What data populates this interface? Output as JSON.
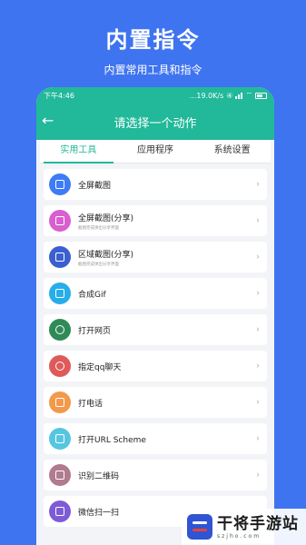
{
  "hero": {
    "title": "内置指令",
    "subtitle": "内置常用工具和指令"
  },
  "statusbar": {
    "time": "下午4:46",
    "net_speed": "...19.0K/s",
    "sim_badge": "④",
    "wifi": "⌔",
    "battery_label": ""
  },
  "navbar": {
    "back_icon": "←",
    "title": "请选择一个动作"
  },
  "tabs": [
    {
      "label": "实用工具",
      "active": true
    },
    {
      "label": "应用程序",
      "active": false
    },
    {
      "label": "系统设置",
      "active": false
    }
  ],
  "items": [
    {
      "label": "全屏截图",
      "sublabel": "",
      "icon": "fullscreen-capture-icon",
      "color": "#3d7cf5"
    },
    {
      "label": "全屏截图(分享)",
      "sublabel": "截图完成弹出分享界面",
      "icon": "fullscreen-capture-share-icon",
      "color": "#d95fd0"
    },
    {
      "label": "区域截图(分享)",
      "sublabel": "截图完成弹出分享界面",
      "icon": "area-capture-share-icon",
      "color": "#3a5fcf"
    },
    {
      "label": "合成Gif",
      "sublabel": "",
      "icon": "gif-icon",
      "color": "#27aee8"
    },
    {
      "label": "打开网页",
      "sublabel": "",
      "icon": "globe-icon",
      "color": "#2e8b57"
    },
    {
      "label": "指定qq聊天",
      "sublabel": "",
      "icon": "qq-icon",
      "color": "#e05a5a"
    },
    {
      "label": "打电话",
      "sublabel": "",
      "icon": "phone-icon",
      "color": "#f2994a"
    },
    {
      "label": "打开URL Scheme",
      "sublabel": "",
      "icon": "url-scheme-icon",
      "color": "#56c6e0"
    },
    {
      "label": "识别二维码",
      "sublabel": "",
      "icon": "qrcode-icon",
      "color": "#b07a8f"
    },
    {
      "label": "微信扫一扫",
      "sublabel": "",
      "icon": "wechat-scan-icon",
      "color": "#7d5bd6"
    }
  ],
  "chevron": "›",
  "watermark": {
    "name": "干将手游站",
    "url": "szjho.com"
  },
  "colors": {
    "background": "#3f74f0",
    "header": "#22b89a",
    "accent": "#22b89a"
  }
}
